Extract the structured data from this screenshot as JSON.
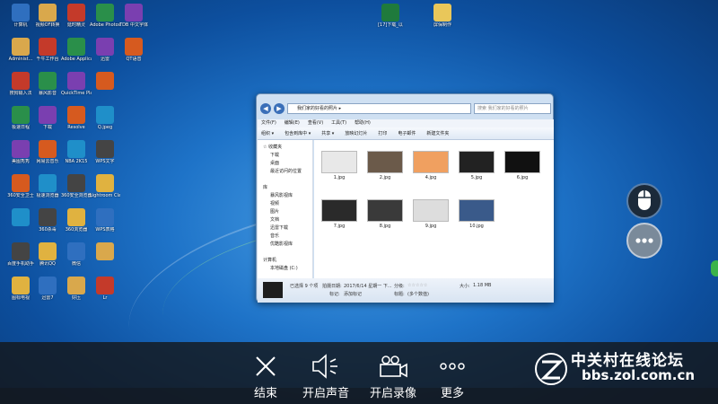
{
  "desktop": {
    "icons_col1": [
      "计算机",
      "Administ...",
      "搜狗输入法",
      "极速日程",
      "美图秀秀",
      "360安全卫士",
      "",
      "百度手机助手",
      "图标电视"
    ],
    "icons_col2": [
      "视频OF转换",
      "千牛工作台",
      "暴风影音",
      "下载",
      "网易云音乐",
      "极速浏览器",
      "360杀毒",
      "腾讯QQ",
      "迅雷7"
    ],
    "icons_col3": [
      "延时精灵",
      "Adobe Applicati...",
      "QuickTime Player",
      "Resolve",
      "NBA 2K15",
      "360安全浏览器",
      "360浏览器",
      "微信",
      "好压"
    ],
    "icons_col4": [
      "Adobe Photosh...",
      "迅雷",
      "",
      "Q.jpeg",
      "WPS文字",
      "Lightroom Classic",
      "WPS表格",
      "",
      "Lr"
    ],
    "icons_col5": [
      "TDB 中文字体",
      "QT语音",
      "",
      "",
      "",
      "",
      "",
      "",
      ""
    ],
    "top_files": [
      "[17]下载_以",
      "屏保制作"
    ]
  },
  "explorer": {
    "address": "我们家的好看的照片 ▸",
    "search_placeholder": "搜索 我们家的好看的照片",
    "menu": [
      "文件(F)",
      "编辑(E)",
      "查看(V)",
      "工具(T)",
      "帮助(H)"
    ],
    "toolbar": [
      "组织 ▾",
      "包含到库中 ▾",
      "共享 ▾",
      "放映幻灯片",
      "打印",
      "电子邮件",
      "新建文件夹"
    ],
    "nav": [
      {
        "label": "☆ 收藏夹",
        "sub": false
      },
      {
        "label": "下载",
        "sub": true
      },
      {
        "label": "桌面",
        "sub": true
      },
      {
        "label": "最近访问的位置",
        "sub": true
      },
      {
        "label": "",
        "sub": false
      },
      {
        "label": "库",
        "sub": false
      },
      {
        "label": "暴风影视库",
        "sub": true
      },
      {
        "label": "视频",
        "sub": true
      },
      {
        "label": "图片",
        "sub": true
      },
      {
        "label": "文档",
        "sub": true
      },
      {
        "label": "迅雷下载",
        "sub": true
      },
      {
        "label": "音乐",
        "sub": true
      },
      {
        "label": "优酷影视库",
        "sub": true
      },
      {
        "label": "",
        "sub": false
      },
      {
        "label": "计算机",
        "sub": false
      },
      {
        "label": "本地磁盘 (C:)",
        "sub": true
      }
    ],
    "files": [
      "1.jpg",
      "2.jpg",
      "4.jpg",
      "5.jpg",
      "6.jpg",
      "7.jpg",
      "8.jpg",
      "9.jpg",
      "10.jpg"
    ],
    "details": {
      "selected": "已选择 9 个项",
      "date_label": "拍摄日期:",
      "date_value": "2017/6/14 星期一 下...",
      "tags_label": "标记:",
      "tags_value": "添加标记",
      "rating_label": "分级:",
      "rating_value": "☆☆☆☆☆",
      "title_label": "标题:",
      "title_value": "(多个数值)",
      "size_label": "大小:",
      "size_value": "1.18 MB"
    }
  },
  "controls": {
    "end": "结束",
    "sound": "开启声音",
    "record": "开启录像",
    "more": "更多"
  },
  "watermark": {
    "cn": "中关村在线论坛",
    "url": "bbs.zol.com.cn"
  },
  "colors": {
    "overlay": "#141414",
    "desktop": "#1e73c8"
  }
}
